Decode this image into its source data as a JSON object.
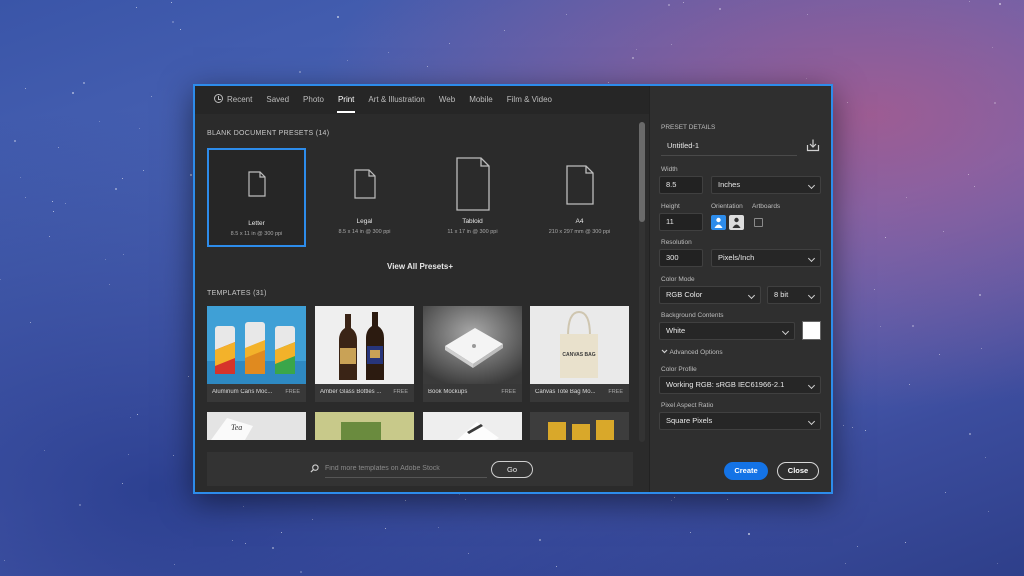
{
  "tabs": [
    {
      "label": "Recent"
    },
    {
      "label": "Saved"
    },
    {
      "label": "Photo"
    },
    {
      "label": "Print",
      "active": true
    },
    {
      "label": "Art & Illustration"
    },
    {
      "label": "Web"
    },
    {
      "label": "Mobile"
    },
    {
      "label": "Film & Video"
    }
  ],
  "blank_presets": {
    "title": "BLANK DOCUMENT PRESETS",
    "count": "(14)",
    "items": [
      {
        "name": "Letter",
        "size": "8.5 x 11 in @ 300 ppi",
        "icon": "document-icon",
        "selected": true
      },
      {
        "name": "Legal",
        "size": "8.5 x 14 in @ 300 ppi",
        "icon": "document-icon"
      },
      {
        "name": "Tabloid",
        "size": "11 x 17 in @ 300 ppi",
        "icon": "document-icon"
      },
      {
        "name": "A4",
        "size": "210 x 297 mm @ 300 ppi",
        "icon": "document-icon"
      }
    ],
    "view_all_label": "View All Presets+"
  },
  "templates": {
    "title": "TEMPLATES",
    "count": "(31)",
    "items": [
      {
        "name": "Aluminum Cans Moc...",
        "badge": "FREE"
      },
      {
        "name": "Amber Glass Bottles ...",
        "badge": "FREE"
      },
      {
        "name": "Book Mockups",
        "badge": "FREE"
      },
      {
        "name": "Canvas Tote Bag Mo...",
        "badge": "FREE"
      }
    ]
  },
  "search": {
    "placeholder": "Find more templates on Adobe Stock",
    "go_label": "Go"
  },
  "preset_details": {
    "title": "PRESET DETAILS",
    "name_value": "Untitled-1",
    "width_label": "Width",
    "width_value": "8.5",
    "width_unit": "Inches",
    "height_label": "Height",
    "height_value": "11",
    "orientation_label": "Orientation",
    "artboards_label": "Artboards",
    "resolution_label": "Resolution",
    "resolution_value": "300",
    "resolution_unit": "Pixels/Inch",
    "color_mode_label": "Color Mode",
    "color_mode_value": "RGB Color",
    "bit_depth_value": "8 bit",
    "bg_contents_label": "Background Contents",
    "bg_contents_value": "White",
    "bg_swatch_color": "#ffffff",
    "advanced_label": "Advanced Options",
    "color_profile_label": "Color Profile",
    "color_profile_value": "Working RGB: sRGB IEC61966-2.1",
    "pixel_aspect_label": "Pixel Aspect Ratio",
    "pixel_aspect_value": "Square Pixels",
    "create_label": "Create",
    "close_label": "Close"
  },
  "colors": {
    "accent": "#1473e6",
    "selection_border": "#2d8ceb",
    "dialog_bg": "#2b2b2b",
    "panel_bg": "#2f2f2f"
  }
}
